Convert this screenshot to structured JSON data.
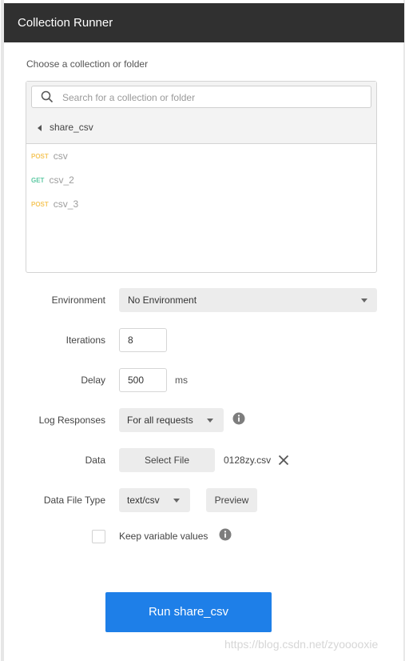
{
  "header": {
    "title": "Collection Runner"
  },
  "collection": {
    "label": "Choose a collection or folder",
    "search_placeholder": "Search for a collection or folder",
    "folder": "share_csv",
    "requests": [
      {
        "method": "POST",
        "name": "csv"
      },
      {
        "method": "GET",
        "name": "csv_2"
      },
      {
        "method": "POST",
        "name": "csv_3"
      }
    ]
  },
  "form": {
    "environment_label": "Environment",
    "environment_value": "No Environment",
    "iterations_label": "Iterations",
    "iterations_value": "8",
    "delay_label": "Delay",
    "delay_value": "500",
    "delay_unit": "ms",
    "log_label": "Log Responses",
    "log_value": "For all requests",
    "data_label": "Data",
    "select_file_label": "Select File",
    "file_name": "0128zy.csv",
    "data_type_label": "Data File Type",
    "data_type_value": "text/csv",
    "preview_label": "Preview",
    "keep_values_label": "Keep variable values",
    "keep_values_checked": false
  },
  "run_button": {
    "label": "Run share_csv"
  },
  "watermark": "https://blog.csdn.net/zyooooxie",
  "colors": {
    "header_bg": "#303030",
    "primary": "#1e7fe8",
    "post": "#f5c75e",
    "get": "#5dc9a3"
  }
}
